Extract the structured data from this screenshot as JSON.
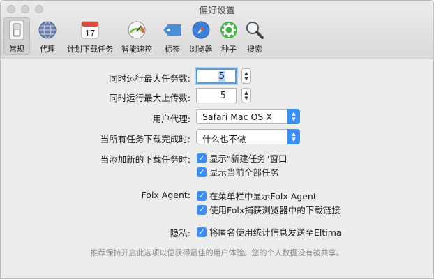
{
  "window": {
    "title": "偏好设置"
  },
  "toolbar": {
    "items": [
      {
        "label": "常规",
        "icon": "general-switch-icon"
      },
      {
        "label": "代理",
        "icon": "globe-icon"
      },
      {
        "label": "计划下载任务",
        "icon": "calendar-icon",
        "calendar_day": "17"
      },
      {
        "label": "智能速控",
        "icon": "speedometer-icon"
      },
      {
        "label": "标签",
        "icon": "tag-icon"
      },
      {
        "label": "浏览器",
        "icon": "compass-icon"
      },
      {
        "label": "种子",
        "icon": "gear-icon"
      },
      {
        "label": "搜索",
        "icon": "magnifier-icon"
      }
    ],
    "selected": "常规"
  },
  "settings": {
    "max_tasks_label": "同时运行最大任务数:",
    "max_tasks_value": "5",
    "max_uploads_label": "同时运行最大上传数:",
    "max_uploads_value": "5",
    "user_agent_label": "用户代理:",
    "user_agent_value": "Safari Mac OS X",
    "on_complete_label": "当所有任务下载完成时:",
    "on_complete_value": "什么也不做",
    "on_new_task_label": "当添加新的下载任务时:",
    "show_new_task_window": "显示\"新建任务\"窗口",
    "show_all_tasks": "显示当前全部任务",
    "folx_agent_label": "Folx Agent:",
    "show_in_menubar": "在菜单栏中显示Folx Agent",
    "capture_browser": "使用Folx捕获浏览器中的下载链接",
    "privacy_label": "隐私:",
    "send_stats": "将匿名使用统计信息发送至Eltima",
    "footnote": "推荐保持开启此选项以便获得最佳的用户体验。您的个人数据没有被共享。"
  },
  "colors": {
    "accent": "#3b8ef3",
    "window_bg": "#ececec"
  }
}
